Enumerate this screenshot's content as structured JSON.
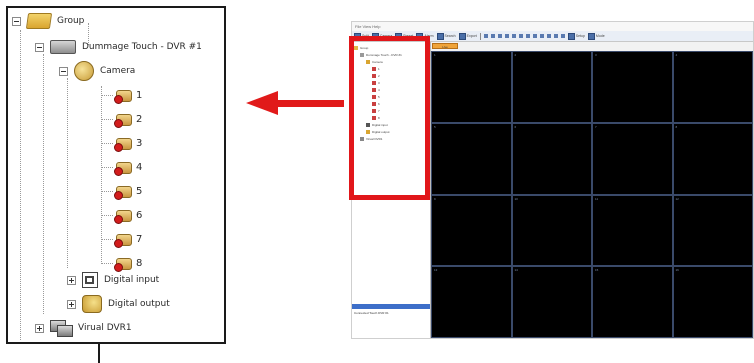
{
  "tree": {
    "root_label": "Group",
    "dvr_label": "Dummage Touch - DVR #1",
    "camera_group_label": "Camera",
    "cameras": [
      "1",
      "2",
      "3",
      "4",
      "5",
      "6",
      "7",
      "8"
    ],
    "digital_input_label": "Digital input",
    "digital_output_label": "Digital output",
    "virtual_dvr_label": "Virual DVR1"
  },
  "app": {
    "menu": "File  View  Help",
    "toolbar": [
      "Split",
      "Camera",
      "Preset",
      "Alarm",
      "Search",
      "Export",
      "Setup",
      "Mode"
    ],
    "active_tab": "Live",
    "status_text": "Connected  Touch DVR #1"
  },
  "colors": {
    "highlight": "#e1161a",
    "arrow": "#e11a1a",
    "video_bg": "#000000",
    "grid_lines": "#3a4a6a"
  }
}
